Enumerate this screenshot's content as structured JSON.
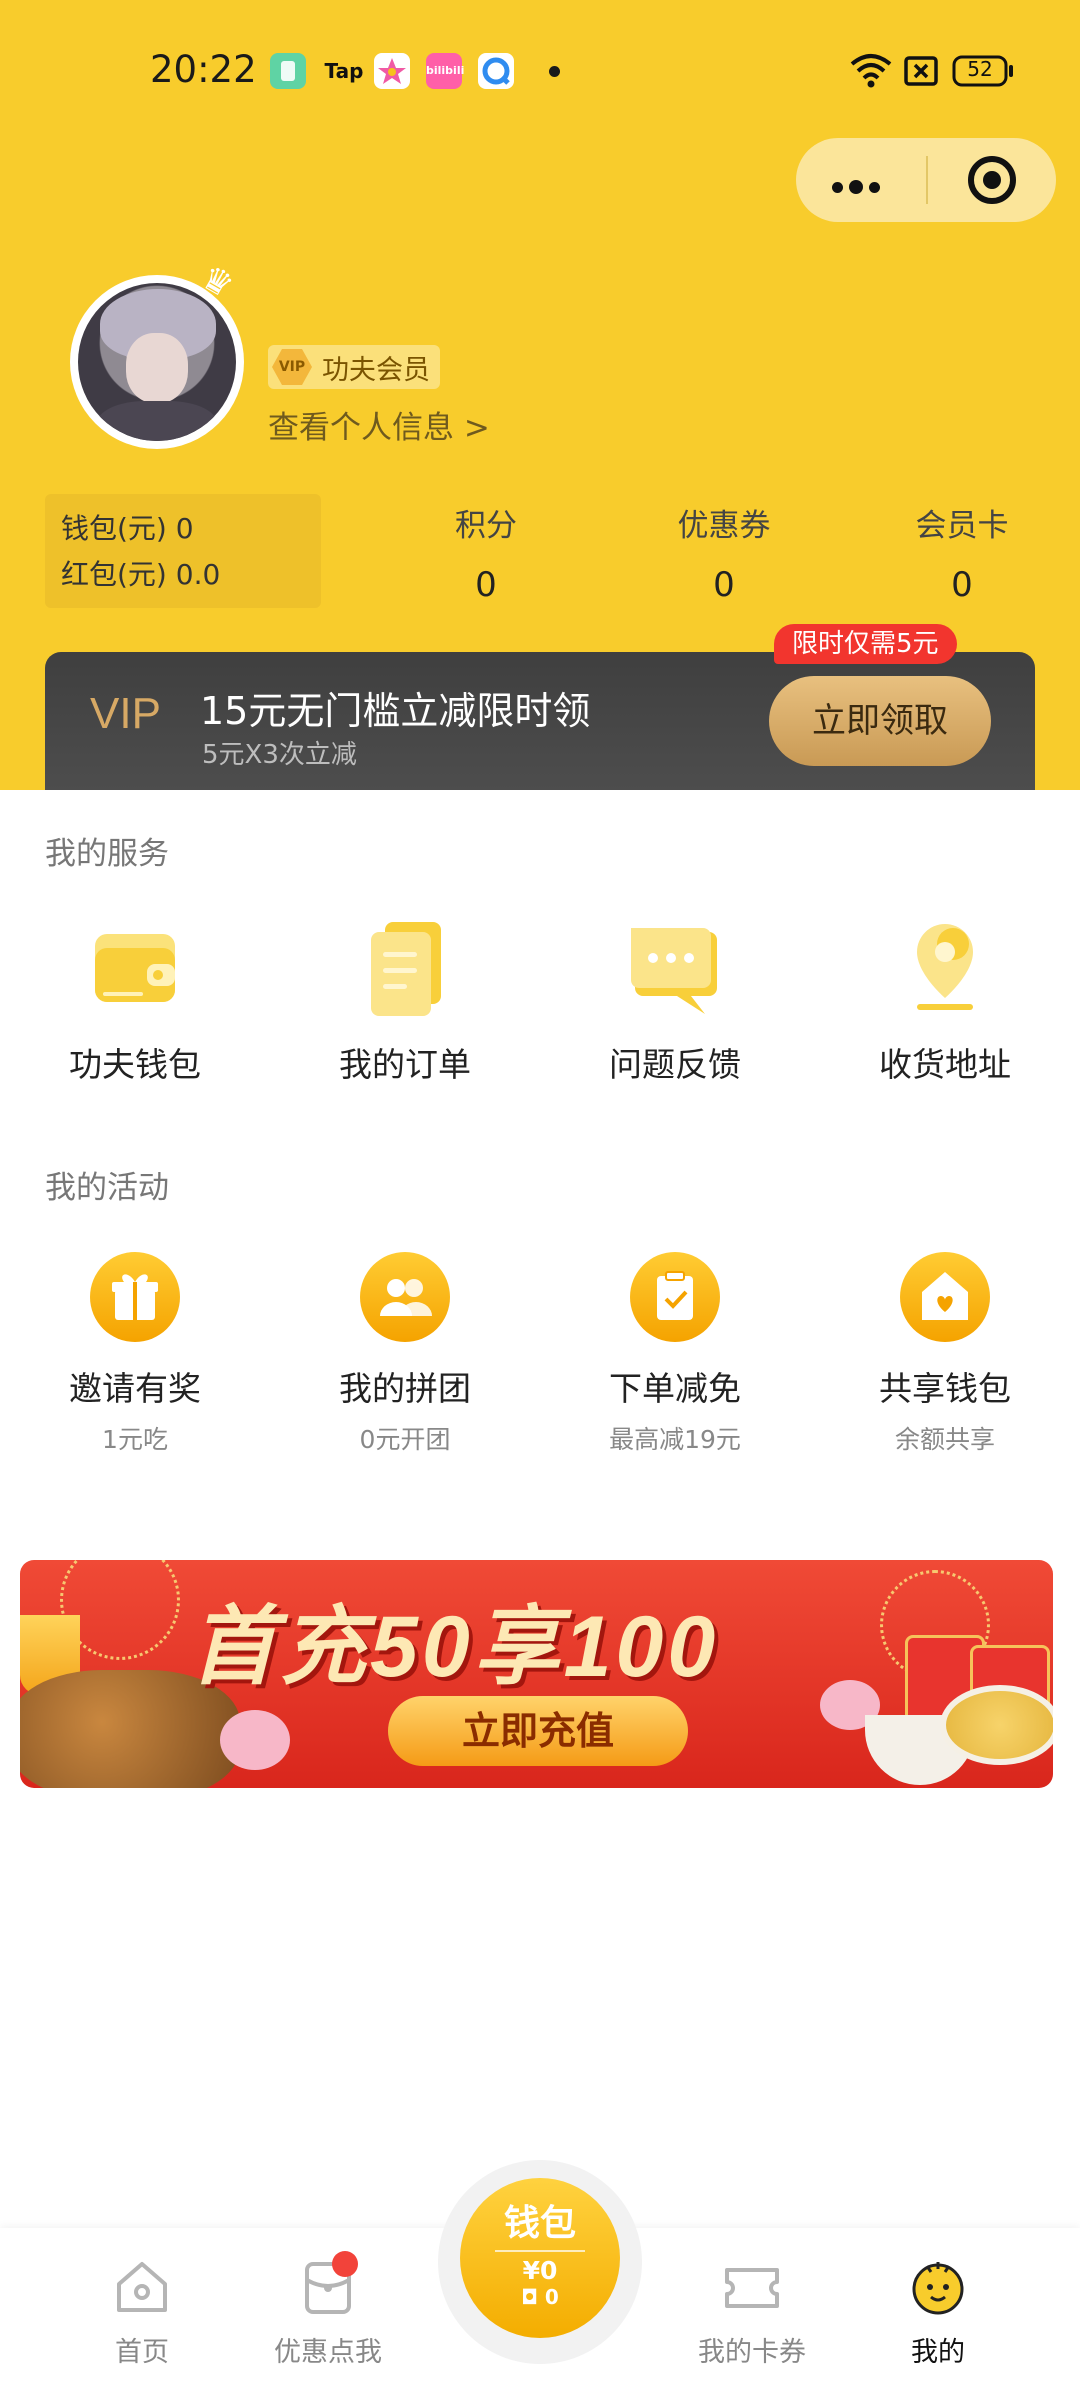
{
  "status_bar": {
    "time": "20:22",
    "apps": [
      "tap",
      "bilibili"
    ],
    "app_labels": {
      "tap": "Tap",
      "bilibili": "bilibili"
    },
    "battery": "52"
  },
  "capsule": {
    "more_icon": "more-dots-icon",
    "close_icon": "target-icon"
  },
  "profile": {
    "member_badge": "VIP",
    "member_label": "功夫会员",
    "view_info": "查看个人信息 >"
  },
  "stats": {
    "wallet_label": "钱包(元)",
    "wallet_value": "0",
    "redpacket_label": "红包(元)",
    "redpacket_value": "0.0",
    "items": [
      {
        "label": "积分",
        "value": "0"
      },
      {
        "label": "优惠券",
        "value": "0"
      },
      {
        "label": "会员卡",
        "value": "0"
      }
    ]
  },
  "vip_card": {
    "vip_text": "VIP",
    "title": "15元无门槛立减限时领",
    "subtitle": "5元X3次立减",
    "button": "立即领取",
    "limit_tag": "限时仅需5元"
  },
  "services": {
    "title": "我的服务",
    "items": [
      {
        "label": "功夫钱包",
        "icon": "wallet-icon"
      },
      {
        "label": "我的订单",
        "icon": "order-icon"
      },
      {
        "label": "问题反馈",
        "icon": "feedback-icon"
      },
      {
        "label": "收货地址",
        "icon": "location-icon"
      }
    ]
  },
  "activities": {
    "title": "我的活动",
    "items": [
      {
        "label": "邀请有奖",
        "sub": "1元吃",
        "icon": "gift-icon"
      },
      {
        "label": "我的拼团",
        "sub": "0元开团",
        "icon": "group-icon"
      },
      {
        "label": "下单减免",
        "sub": "最高减19元",
        "icon": "clipboard-check-icon"
      },
      {
        "label": "共享钱包",
        "sub": "余额共享",
        "icon": "home-heart-icon"
      }
    ]
  },
  "promo": {
    "title": "首充50享100",
    "button": "立即充值"
  },
  "tabbar": {
    "items": [
      {
        "label": "首页",
        "icon": "home-icon"
      },
      {
        "label": "优惠点我",
        "icon": "coupon-bag-icon"
      },
      {
        "label": "我的卡券",
        "icon": "ticket-icon"
      },
      {
        "label": "我的",
        "icon": "mascot-face-icon"
      }
    ],
    "center": {
      "title": "钱包",
      "money": "¥0",
      "count": "0"
    }
  },
  "colors": {
    "brand_yellow": "#f8cc2c",
    "vip_gold": "#d7a965",
    "red": "#f2352e"
  }
}
